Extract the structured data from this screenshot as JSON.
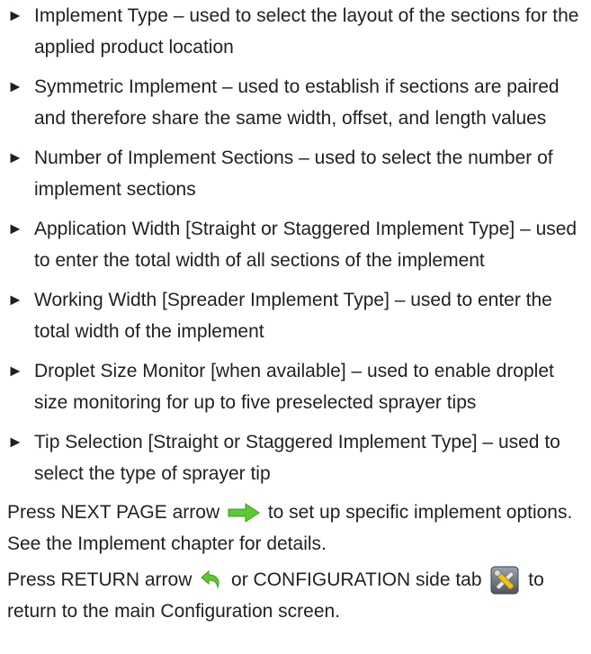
{
  "bullets": [
    "Implement Type – used to select the layout of the sections for the applied product location",
    "Symmetric Implement – used to establish if sections are paired and therefore share the same width, offset, and length values",
    "Number of Implement Sections – used to select the number of implement sections",
    "Application Width [Straight or Staggered Implement Type] – used to enter the total width of all sections of the implement",
    "Working Width [Spreader Implement Type] – used to enter the total width of the implement",
    "Droplet Size Monitor [when available] – used to enable droplet size monitoring for up to five preselected sprayer tips",
    "Tip Selection [Straight or Staggered Implement Type] – used to select the type of sprayer tip"
  ],
  "bullet_marker": "►",
  "next_page": {
    "before": "Press NEXT PAGE arrow",
    "after": "to set up specific implement options. See the Implement chapter for details.",
    "icon": "next-page-arrow-icon",
    "icon_color": "#5cc832"
  },
  "return": {
    "before": "Press RETURN arrow",
    "middle": "or CONFIGURATION side tab",
    "after": "to return to the main Configuration screen.",
    "return_icon": "return-arrow-icon",
    "return_icon_color": "#5cc832",
    "config_icon": "configuration-tools-icon"
  }
}
